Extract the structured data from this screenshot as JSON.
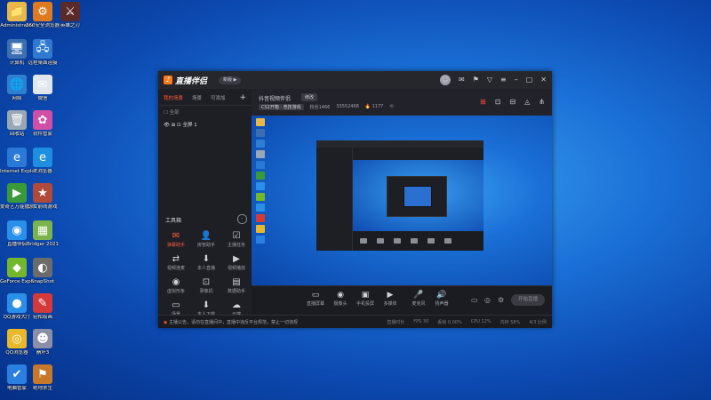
{
  "desktop": {
    "icons": [
      {
        "label": "Administrator",
        "glyph": "📁",
        "color": "#e8b84a"
      },
      {
        "label": "360安全浏览器",
        "glyph": "⚙",
        "color": "#e07a20"
      },
      {
        "label": "英雄之刃",
        "glyph": "⚔",
        "color": "#5a2a2a"
      },
      {
        "label": "计算机",
        "glyph": "🖥",
        "color": "#3b6fb0"
      },
      {
        "label": "远程桌面连接",
        "glyph": "🖧",
        "color": "#2f7ad0"
      },
      {
        "label": "网络",
        "glyph": "🌐",
        "color": "#2e7fcf"
      },
      {
        "label": "微信",
        "glyph": "✉",
        "color": "#e0e6ee"
      },
      {
        "label": "回收站",
        "glyph": "🗑",
        "color": "#9aa7b5"
      },
      {
        "label": "软件管家",
        "glyph": "✿",
        "color": "#cf4fa7"
      },
      {
        "label": "Internet Explorer",
        "glyph": "e",
        "color": "#2a79d6"
      },
      {
        "label": "IE浏览器",
        "glyph": "e",
        "color": "#1e8fe0"
      },
      {
        "label": "爱奇艺万能播放器",
        "glyph": "▶",
        "color": "#3a9a3a"
      },
      {
        "label": "少女前线游戏",
        "glyph": "★",
        "color": "#b04a3a"
      },
      {
        "label": "直播伴侣",
        "glyph": "◉",
        "color": "#2a8fe8"
      },
      {
        "label": "Bridger 2021",
        "glyph": "▦",
        "color": "#7ab44a"
      },
      {
        "label": "GeForce Experience",
        "glyph": "◆",
        "color": "#75b72c"
      },
      {
        "label": "SnapShot",
        "glyph": "◐",
        "color": "#6b6b6b"
      },
      {
        "label": "QQ游戏大厅",
        "glyph": "●",
        "color": "#2a8fe8"
      },
      {
        "label": "轻松绘画",
        "glyph": "✎",
        "color": "#d43a3a"
      },
      {
        "label": "QQ浏览器",
        "glyph": "◎",
        "color": "#e8b82a"
      },
      {
        "label": "崩坏3",
        "glyph": "☻",
        "color": "#8a8ea8"
      },
      {
        "label": "电脑管家",
        "glyph": "✔",
        "color": "#2a7fe0"
      },
      {
        "label": "绝地求生",
        "glyph": "⚑",
        "color": "#c8782a"
      }
    ]
  },
  "app": {
    "name": "直播伴侣",
    "version_pill": "新版 ▶",
    "scene_tabs": [
      "我的场景",
      "场景",
      "可添加",
      "+"
    ],
    "sources": [
      "☐ 全部",
      "👁 ⊞ ⊡ 全屏 1"
    ],
    "tools_title": "工具箱",
    "tools": [
      {
        "label": "弹幕助手",
        "glyph": "✉"
      },
      {
        "label": "房管助手",
        "glyph": "👤"
      },
      {
        "label": "主播任务",
        "glyph": "☑"
      },
      {
        "label": "视频连麦",
        "glyph": "⇄"
      },
      {
        "label": "本人直播",
        "glyph": "⬇"
      },
      {
        "label": "视频播放",
        "glyph": "▶"
      },
      {
        "label": "虚拟形象",
        "glyph": "◉"
      },
      {
        "label": "录像机",
        "glyph": "⊡"
      },
      {
        "label": "数据助手",
        "glyph": "▤"
      },
      {
        "label": "场景",
        "glyph": "▭"
      },
      {
        "label": "本人下载",
        "glyph": "⬇"
      },
      {
        "label": "云端",
        "glyph": "☁"
      }
    ],
    "room": {
      "title": "抖音视频伴侣",
      "tag": "修改",
      "category": "CS2开箱 · 竞技游戏",
      "stats": [
        "粉丝1466",
        "33552468",
        "🔥 1177",
        "⟲"
      ]
    },
    "controls": [
      {
        "label": "直播屏幕",
        "glyph": "▭"
      },
      {
        "label": "摄像头",
        "glyph": "◉"
      },
      {
        "label": "手机投屏",
        "glyph": "▣"
      },
      {
        "label": "多媒体",
        "glyph": "▶"
      },
      {
        "label": "麦克风",
        "glyph": "🎤"
      },
      {
        "label": "扬声器",
        "glyph": "🔊"
      }
    ],
    "start_label": "开始直播",
    "notice": "主播公告，请勿在直播间中，直播中违反平台规范，禁止一切违规",
    "status_stats": [
      "直播时长",
      "FPS 30",
      "丢帧 0.00%",
      "CPU 12%",
      "内存 58%",
      "4/3 比例"
    ]
  }
}
